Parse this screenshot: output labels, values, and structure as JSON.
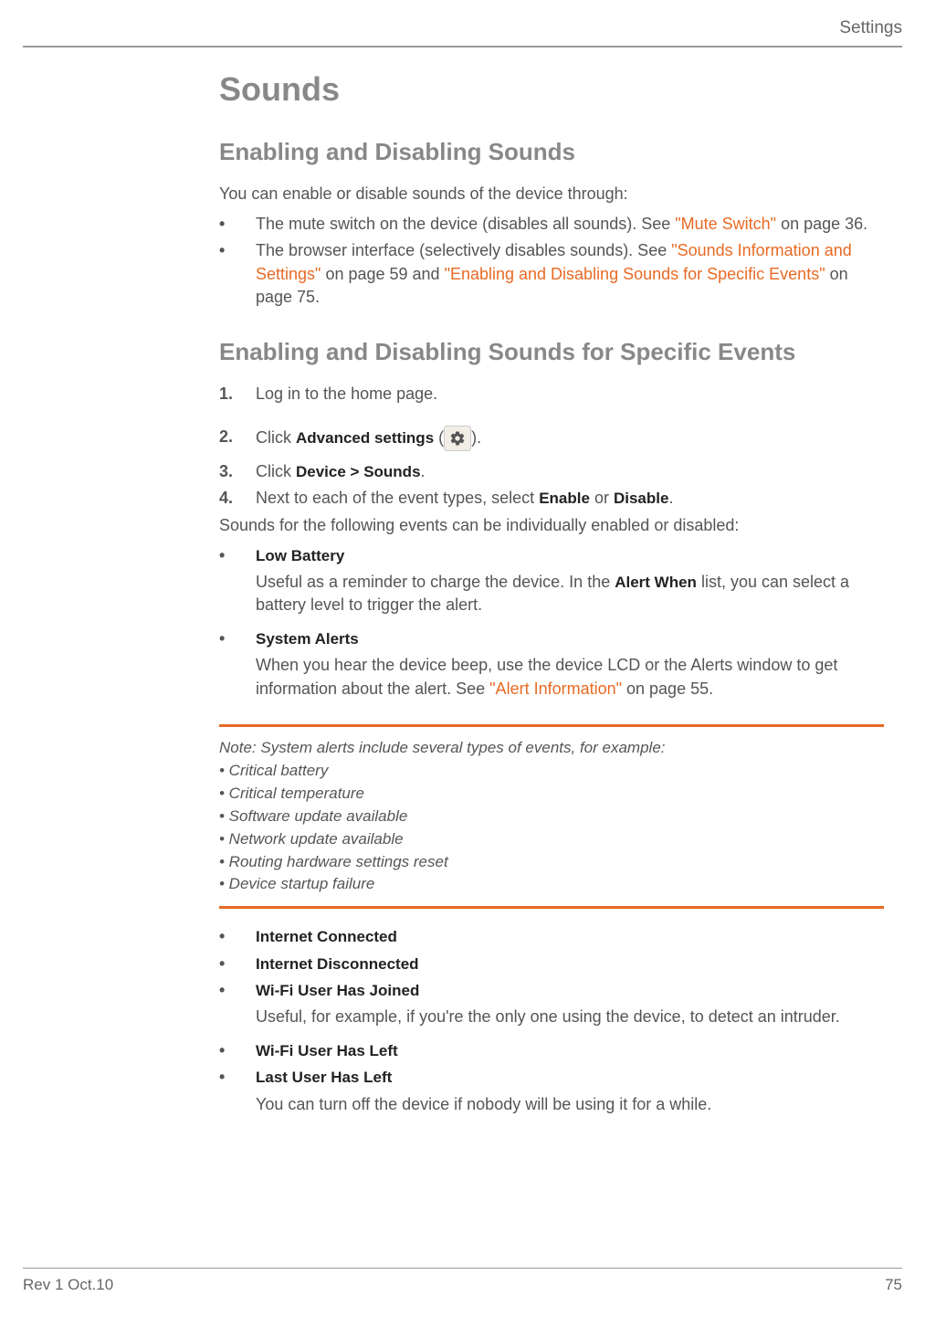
{
  "header": {
    "section": "Settings"
  },
  "title": "Sounds",
  "section1": {
    "heading": "Enabling and Disabling Sounds",
    "intro": "You can enable or disable sounds of the device through:",
    "items": [
      {
        "text_before": "The mute switch on the device (disables all sounds). See ",
        "link": "\"Mute Switch\"",
        "text_after": " on page 36."
      },
      {
        "text_before": "The browser interface (selectively disables sounds). See ",
        "link1": "\"Sounds Information and Settings\"",
        "mid1": " on page 59 and ",
        "link2": "\"Enabling and Disabling Sounds for Specific Events\"",
        "after2": " on page 75."
      }
    ]
  },
  "section2": {
    "heading": "Enabling and Disabling Sounds for Specific Events",
    "steps": [
      {
        "num": "1.",
        "text": "Log in to the home page."
      },
      {
        "num": "2.",
        "prefix": "Click ",
        "bold": "Advanced settings",
        "after_bold": " (",
        "after_icon": ")."
      },
      {
        "num": "3.",
        "prefix": "Click ",
        "bold": "Device > Sounds",
        "suffix": "."
      },
      {
        "num": "4.",
        "prefix": "Next to each of the event types, select ",
        "bold1": "Enable",
        "mid": " or ",
        "bold2": "Disable",
        "suffix": "."
      }
    ],
    "afterSteps": "Sounds for the following events can be individually enabled or disabled:",
    "eventsA": [
      {
        "label": "Low Battery",
        "desc_before": "Useful as a reminder to charge the device. In the ",
        "desc_bold": "Alert When",
        "desc_after": " list, you can select a battery level to trigger the alert."
      },
      {
        "label": "System Alerts",
        "desc_before": "When you hear the device beep, use the device LCD or the Alerts window to get information about the alert. See ",
        "desc_link": "\"Alert Information\"",
        "desc_after": " on page 55."
      }
    ],
    "note": {
      "lead": "Note:  System alerts include several types of events, for example:",
      "items": [
        "•  Critical battery",
        "•  Critical temperature",
        "•  Software update available",
        "•  Network update available",
        "•  Routing hardware settings reset",
        "•  Device startup failure"
      ]
    },
    "eventsB": [
      {
        "label": "Internet Connected"
      },
      {
        "label": "Internet Disconnected"
      },
      {
        "label": "Wi-Fi User Has Joined",
        "desc": "Useful, for example, if you're the only one using the device, to detect an intruder."
      },
      {
        "label": "Wi-Fi User Has Left"
      },
      {
        "label": "Last User Has Left",
        "desc": "You can turn off the device if nobody will be using it for a while."
      }
    ]
  },
  "footer": {
    "left": "Rev 1  Oct.10",
    "right": "75"
  }
}
